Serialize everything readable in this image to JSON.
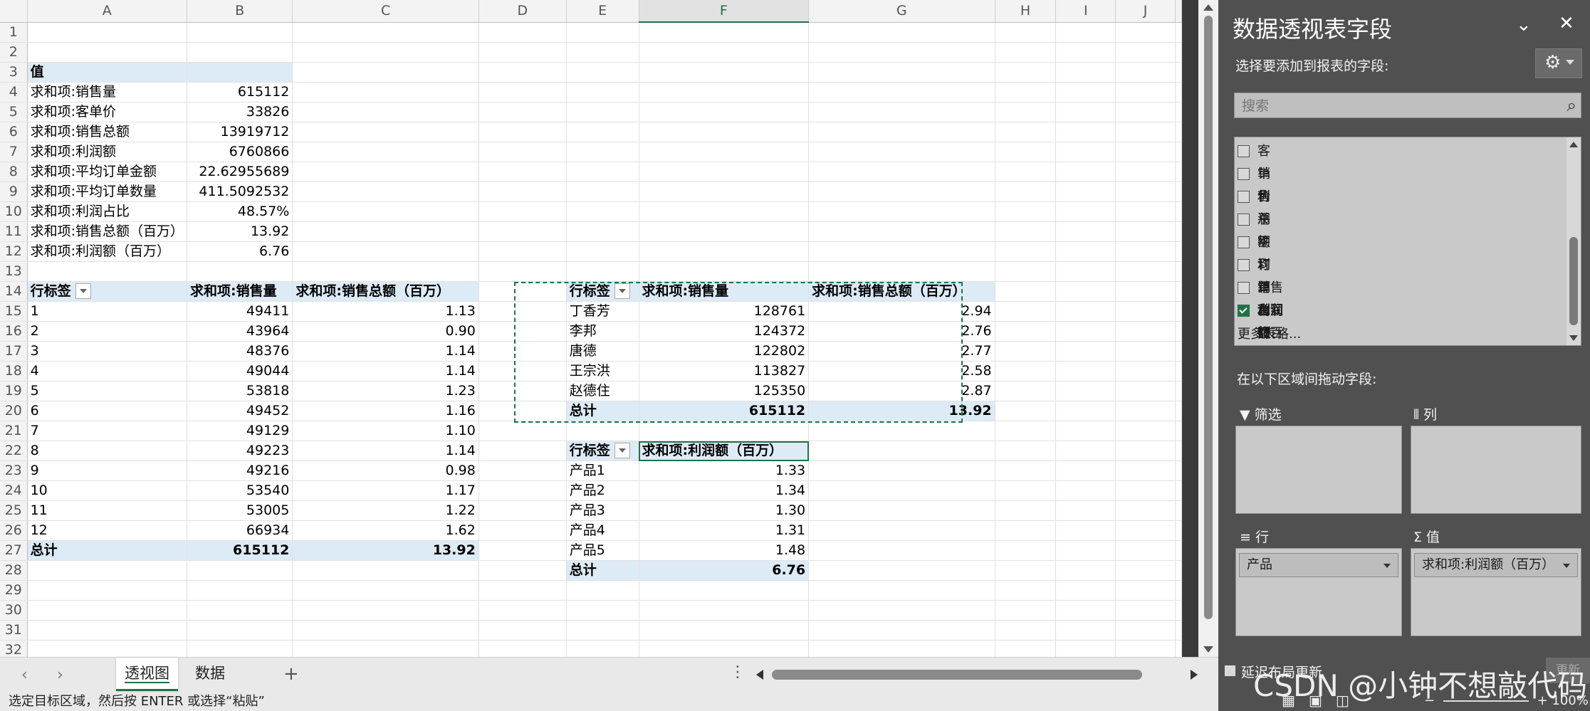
{
  "columns": [
    "A",
    "B",
    "C",
    "D",
    "E",
    "F",
    "G",
    "H",
    "I",
    "J"
  ],
  "rows": [
    "1",
    "2",
    "3",
    "4",
    "5",
    "6",
    "7",
    "8",
    "9",
    "10",
    "11",
    "12",
    "13",
    "14",
    "15",
    "16",
    "17",
    "18",
    "19",
    "20",
    "21",
    "22",
    "23",
    "24",
    "25",
    "26",
    "27",
    "28",
    "29",
    "30",
    "31",
    "32"
  ],
  "values_block": {
    "header": "值",
    "items": [
      {
        "label": "求和项:销售量",
        "value": "615112"
      },
      {
        "label": "求和项:客单价",
        "value": "33826"
      },
      {
        "label": "求和项:销售总额",
        "value": "13919712"
      },
      {
        "label": "求和项:利润额",
        "value": "6760866"
      },
      {
        "label": "求和项:平均订单金额",
        "value": "22.62955689"
      },
      {
        "label": "求和项:平均订单数量",
        "value": "411.5092532"
      },
      {
        "label": "求和项:利润占比",
        "value": "48.57%"
      },
      {
        "label": "求和项:销售总额（百万）",
        "value": "13.92"
      },
      {
        "label": "求和项:利润额（百万）",
        "value": "6.76"
      }
    ]
  },
  "pivot1": {
    "h1": "行标签",
    "h2": "求和项:销售量",
    "h3": "求和项:销售总额（百万）",
    "rows": [
      [
        "1",
        "49411",
        "1.13"
      ],
      [
        "2",
        "43964",
        "0.90"
      ],
      [
        "3",
        "48376",
        "1.14"
      ],
      [
        "4",
        "49044",
        "1.14"
      ],
      [
        "5",
        "53818",
        "1.23"
      ],
      [
        "6",
        "49452",
        "1.16"
      ],
      [
        "7",
        "49129",
        "1.10"
      ],
      [
        "8",
        "49223",
        "1.14"
      ],
      [
        "9",
        "49216",
        "0.98"
      ],
      [
        "10",
        "53540",
        "1.17"
      ],
      [
        "11",
        "53005",
        "1.22"
      ],
      [
        "12",
        "66934",
        "1.62"
      ]
    ],
    "total": [
      "总计",
      "615112",
      "13.92"
    ]
  },
  "pivot2": {
    "h1": "行标签",
    "h2": "求和项:销售量",
    "h3": "求和项:销售总额（百万）",
    "rows": [
      [
        "丁香芳",
        "128761",
        "2.94"
      ],
      [
        "李邦",
        "124372",
        "2.76"
      ],
      [
        "唐德",
        "122802",
        "2.77"
      ],
      [
        "王宗洪",
        "113827",
        "2.58"
      ],
      [
        "赵德住",
        "125350",
        "2.87"
      ]
    ],
    "total": [
      "总计",
      "615112",
      "13.92"
    ]
  },
  "pivot3": {
    "h1": "行标签",
    "h2": "求和项:利润额（百万）",
    "rows": [
      [
        "产品1",
        "1.33"
      ],
      [
        "产品2",
        "1.34"
      ],
      [
        "产品3",
        "1.30"
      ],
      [
        "产品4",
        "1.31"
      ],
      [
        "产品5",
        "1.48"
      ]
    ],
    "total": [
      "总计",
      "6.76"
    ]
  },
  "tabs": {
    "active": "透视图",
    "other": "数据",
    "add": "+"
  },
  "status": {
    "message": "选定目标区域，然后按 ENTER 或选择“粘贴”",
    "zoom": "100%"
  },
  "pane": {
    "title": "数据透视表字段",
    "subtitle": "选择要添加到报表的字段:",
    "search_placeholder": "搜索",
    "fields": [
      {
        "label": "客单价",
        "checked": false
      },
      {
        "label": "销售总额",
        "checked": false
      },
      {
        "label": "利润额",
        "checked": false
      },
      {
        "label": "平均订单金额",
        "checked": false
      },
      {
        "label": "平均订单数量",
        "checked": false
      },
      {
        "label": "利润占比",
        "checked": false
      },
      {
        "label": "销售总额（百万）",
        "checked": false
      },
      {
        "label": "利润额（百万）",
        "checked": true
      }
    ],
    "more": "更多表格...",
    "drag_label": "在以下区域间拖动字段:",
    "filter_label": "筛选",
    "columns_label": "列",
    "rows_label": "行",
    "values_label": "值",
    "rows_chip": "产品",
    "values_chip": "求和项:利润额（百万）",
    "defer_label": "延迟布局更新",
    "update_label": "更新"
  },
  "watermark": "CSDN @小钟不想敲代码"
}
